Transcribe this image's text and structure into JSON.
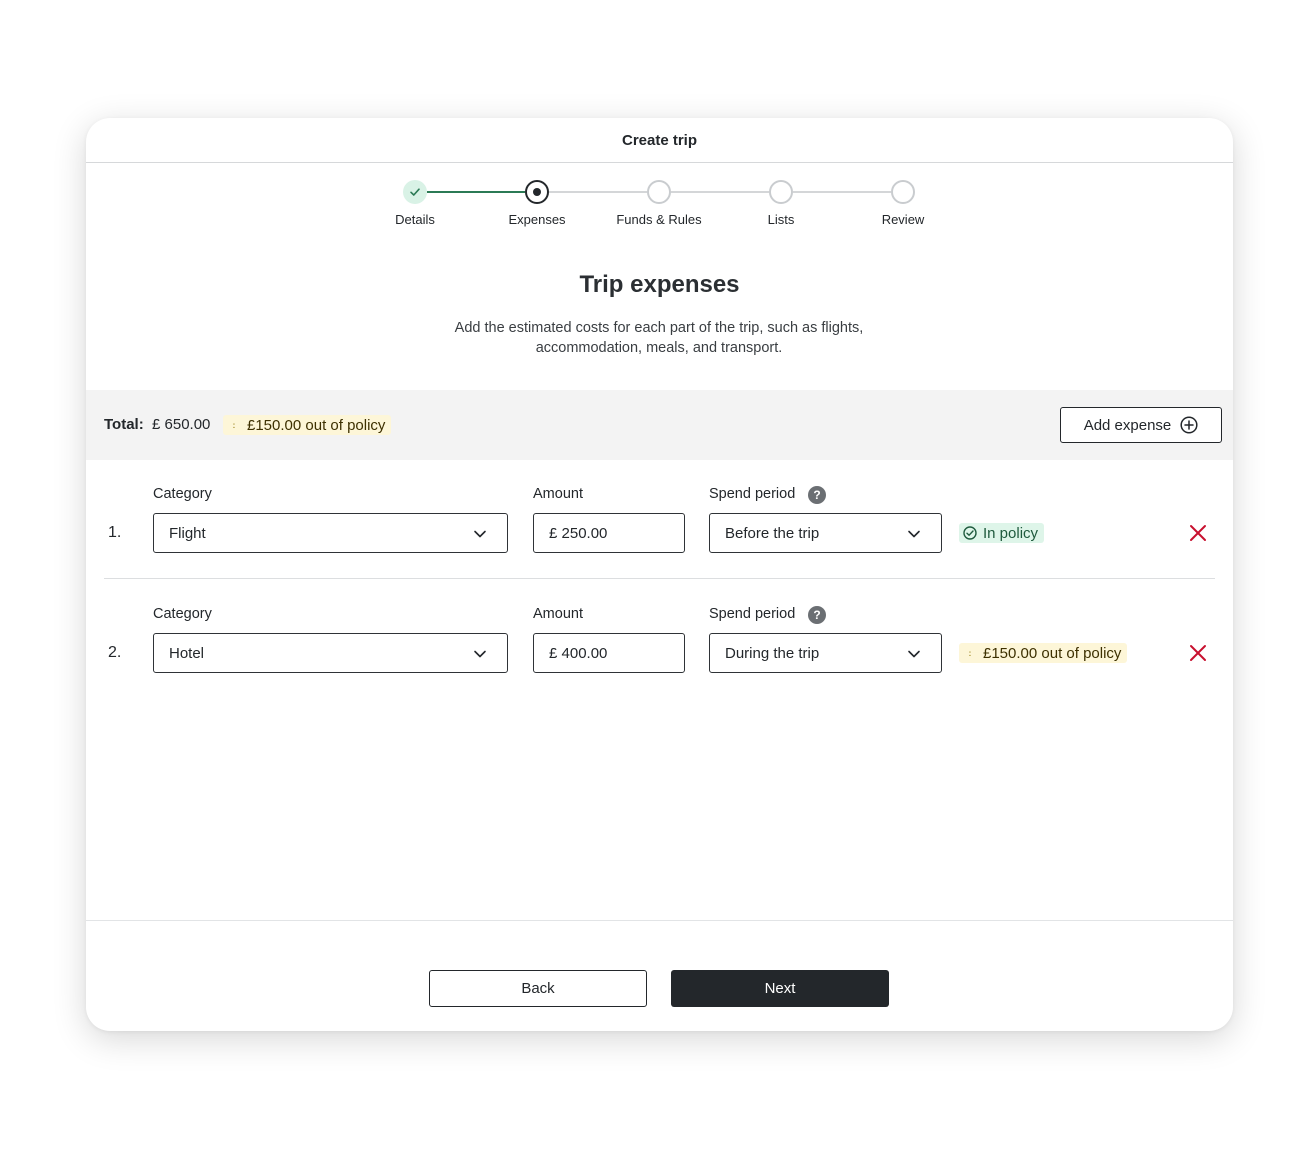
{
  "window": {
    "title": "Create trip"
  },
  "stepper": {
    "steps": [
      {
        "label": "Details",
        "state": "complete"
      },
      {
        "label": "Expenses",
        "state": "current"
      },
      {
        "label": "Funds & Rules",
        "state": "upcoming"
      },
      {
        "label": "Lists",
        "state": "upcoming"
      },
      {
        "label": "Review",
        "state": "upcoming"
      }
    ]
  },
  "page": {
    "heading": "Trip expenses",
    "subtitle": "Add the estimated costs for each part of the trip, such as flights, accommodation, meals, and transport."
  },
  "summary": {
    "total_label": "Total:",
    "total_value": "£ 650.00",
    "policy_badge": "£150.00 out of policy",
    "add_expense_label": "Add expense"
  },
  "expenses": [
    {
      "number": "1.",
      "category_label": "Category",
      "category_value": "Flight",
      "amount_label": "Amount",
      "amount_value": "£ 250.00",
      "spend_period_label": "Spend period",
      "spend_period_value": "Before the trip",
      "policy_status": "In policy",
      "policy_state": "ok"
    },
    {
      "number": "2.",
      "category_label": "Category",
      "category_value": "Hotel",
      "amount_label": "Amount",
      "amount_value": "£ 400.00",
      "spend_period_label": "Spend period",
      "spend_period_value": "During the trip",
      "policy_status": "£150.00 out of policy",
      "policy_state": "warn"
    }
  ],
  "footer": {
    "back_label": "Back",
    "next_label": "Next"
  },
  "icons": {
    "help": "?",
    "warn_marker": ":"
  },
  "colors": {
    "primary_dark": "#23272b",
    "success_green": "#2b7a55",
    "success_bg": "#def5e9",
    "warning_bg": "#fdf6d8",
    "delete_red": "#c8102e"
  }
}
